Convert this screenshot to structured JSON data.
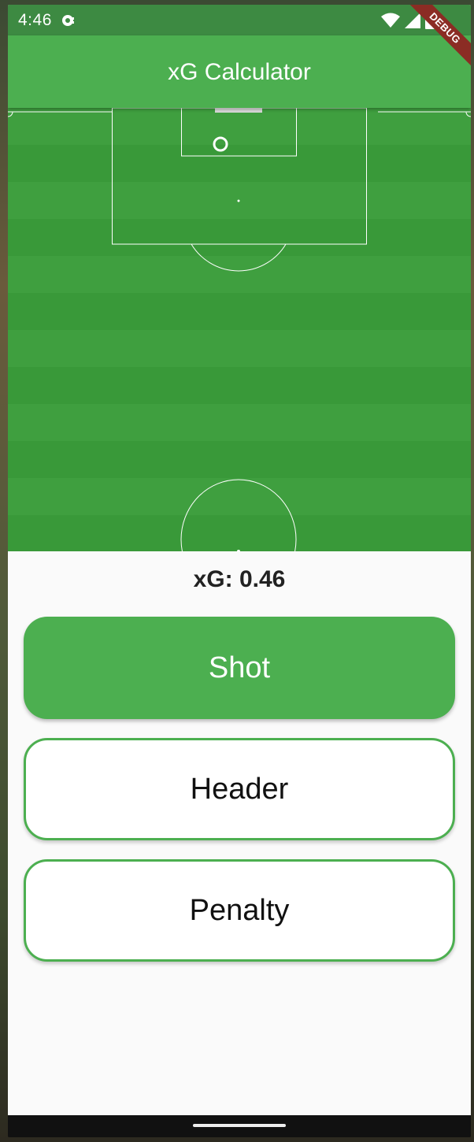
{
  "status_bar": {
    "time": "4:46",
    "notification_icon": "sync-icon",
    "wifi_icon": "wifi-icon",
    "signal_icon": "cell-signal-icon",
    "battery_icon": "battery-icon",
    "debug_banner": "DEBUG"
  },
  "app_bar": {
    "title": "xG Calculator",
    "background": "#4caf50"
  },
  "pitch": {
    "stripe_colors": [
      "#3f9f3f",
      "#399939"
    ],
    "line_color": "#ffffff",
    "shot_marker_icon": "shot-location-marker"
  },
  "result": {
    "xg_text": "xG: 0.46"
  },
  "buttons": {
    "shot": "Shot",
    "header": "Header",
    "penalty": "Penalty"
  },
  "colors": {
    "accent": "#4caf50",
    "status_bar": "#3d8a42",
    "debug_ribbon": "#8b2c24"
  }
}
